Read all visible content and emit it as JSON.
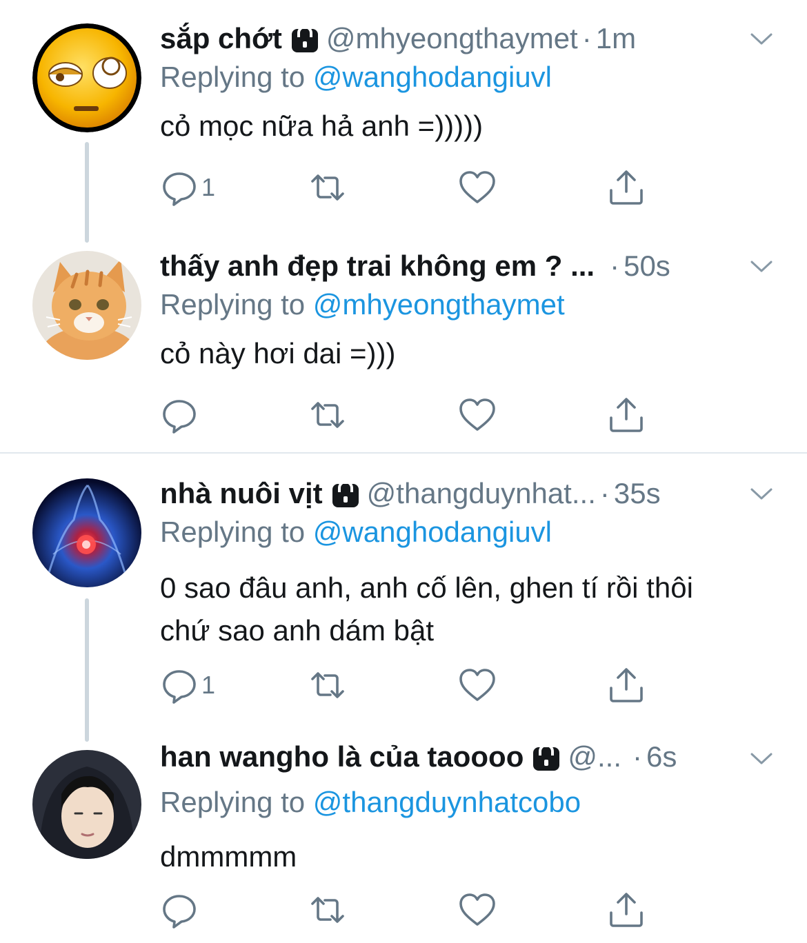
{
  "colors": {
    "text": "#14171a",
    "secondary": "#657786",
    "mention": "#1b95e0",
    "connector": "#ccd6dd",
    "divider": "#e1e8ed"
  },
  "tweets": [
    {
      "name": "sắp chớt",
      "locked": true,
      "handle": "@mhyeongthaymet",
      "sep": "·",
      "time": "1m",
      "replying_prefix": "Replying to",
      "replying_to": "@wanghodangiuvl",
      "text": "cỏ mọc nữa hả anh =)))))",
      "reply_count": "1",
      "avatar": "rolling-eyes-emoji-avatar"
    },
    {
      "name": "thấy anh đẹp trai không em ? ...",
      "locked": false,
      "handle": "",
      "sep": "·",
      "time": "50s",
      "replying_prefix": "Replying to",
      "replying_to": "@mhyeongthaymet",
      "text": "cỏ này hơi dai =)))",
      "reply_count": "",
      "avatar": "orange-cat-avatar"
    },
    {
      "name": "nhà nuôi vịt",
      "locked": true,
      "handle": "@thangduynhat...",
      "sep": "·",
      "time": "35s",
      "replying_prefix": "Replying to",
      "replying_to": "@wanghodangiuvl",
      "text_line1": "0 sao đâu anh, anh cố lên, ghen tí rồi thôi",
      "text_line2": "chứ sao anh dám bật",
      "reply_count": "1",
      "avatar": "glowing-heart-xray-avatar"
    },
    {
      "name": "han wangho là của taoooo",
      "locked": true,
      "handle": "@...",
      "sep": "·",
      "time": "6s",
      "replying_prefix": "Replying to",
      "replying_to": "@thangduynhatcobo",
      "text": "dmmmmm",
      "reply_count": "",
      "avatar": "hooded-person-avatar"
    }
  ]
}
